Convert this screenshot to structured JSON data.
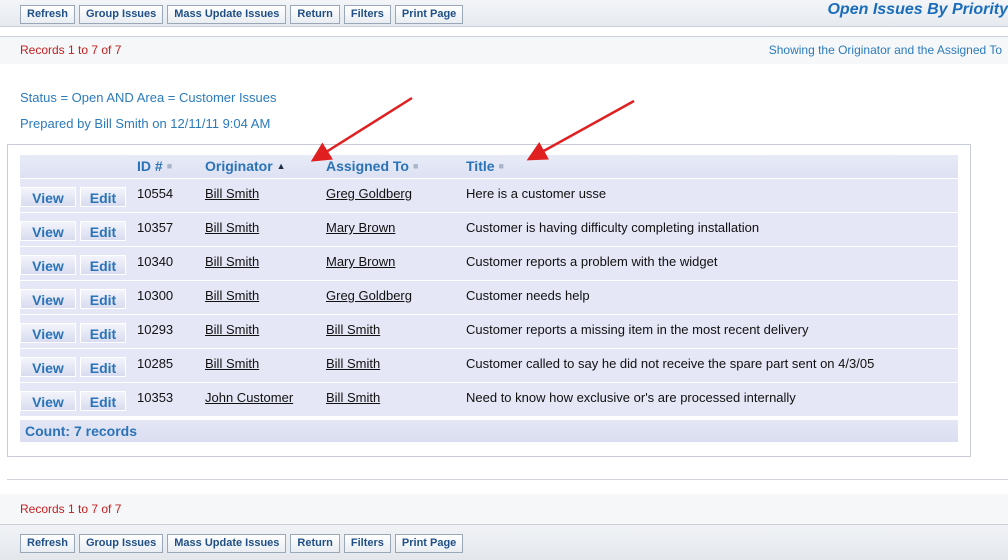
{
  "toolbar": {
    "buttons": [
      "Refresh",
      "Group Issues",
      "Mass Update Issues",
      "Return",
      "Filters",
      "Print Page"
    ]
  },
  "page_title": "Open Issues By Priority",
  "records_text": "Records 1 to 7 of 7",
  "showing_text": "Showing the Originator and the Assigned To",
  "criteria": {
    "line1": "Status = Open AND Area = Customer Issues",
    "line2": "Prepared by Bill Smith on 12/11/11 9:04 AM"
  },
  "table": {
    "columns": [
      {
        "label": "ID #",
        "sort_icon": "sort-neutral-icon"
      },
      {
        "label": "Originator",
        "sort_icon": "sort-ascending-icon"
      },
      {
        "label": "Assigned To",
        "sort_icon": "sort-neutral-icon"
      },
      {
        "label": "Title",
        "sort_icon": "sort-neutral-icon"
      }
    ],
    "view_label": "View",
    "edit_label": "Edit",
    "rows": [
      {
        "id": "10554",
        "originator": "Bill Smith",
        "assigned": "Greg Goldberg",
        "title": "Here is a customer usse"
      },
      {
        "id": "10357",
        "originator": "Bill Smith",
        "assigned": "Mary Brown",
        "title": "Customer is having difficulty completing installation"
      },
      {
        "id": "10340",
        "originator": "Bill Smith",
        "assigned": "Mary Brown",
        "title": "Customer reports a problem with the widget"
      },
      {
        "id": "10300",
        "originator": "Bill Smith",
        "assigned": "Greg Goldberg",
        "title": "Customer needs help"
      },
      {
        "id": "10293",
        "originator": "Bill Smith",
        "assigned": "Bill Smith",
        "title": "Customer reports a missing item in the most recent delivery"
      },
      {
        "id": "10285",
        "originator": "Bill Smith",
        "assigned": "Bill Smith",
        "title": "Customer called to say he did not receive the spare part sent on 4/3/05"
      },
      {
        "id": "10353",
        "originator": "John Customer",
        "assigned": "Bill Smith",
        "title": "Need to know how exclusive or's are processed internally"
      }
    ],
    "count_text": "Count: 7 records"
  },
  "colors": {
    "accent": "#2a73b8",
    "records": "#c42020",
    "row_bg": "#e5e6f6",
    "annotation_arrow": "#e02020"
  }
}
